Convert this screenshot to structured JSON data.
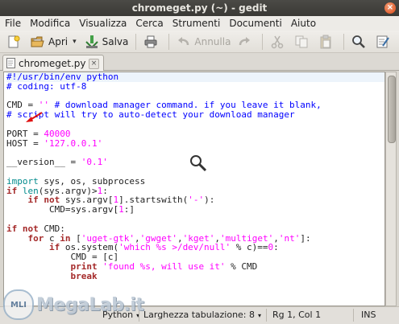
{
  "window": {
    "title": "chromeget.py (~) - gedit",
    "close_symbol": "×"
  },
  "menubar": {
    "items": [
      "File",
      "Modifica",
      "Visualizza",
      "Cerca",
      "Strumenti",
      "Documenti",
      "Aiuto"
    ]
  },
  "toolbar": {
    "open_label": "Apri",
    "save_label": "Salva",
    "undo_label": "Annulla",
    "dropdown_symbol": "▾"
  },
  "tab": {
    "label": "chromeget.py",
    "close_symbol": "×"
  },
  "editor": {
    "lines": [
      [
        {
          "t": "#!/usr/bin/env python",
          "c": "pp"
        }
      ],
      [
        {
          "t": "# coding: utf-8",
          "c": "cmt"
        }
      ],
      [],
      [
        {
          "t": "CMD = "
        },
        {
          "t": "''",
          "c": "str"
        },
        {
          "t": " # download manager command. if you leave it blank,",
          "c": "cmt"
        }
      ],
      [
        {
          "t": "# script will try to auto-detect your download manager",
          "c": "cmt"
        }
      ],
      [],
      [
        {
          "t": "PORT = "
        },
        {
          "t": "40000",
          "c": "num"
        }
      ],
      [
        {
          "t": "HOST = "
        },
        {
          "t": "'127.0.0.1'",
          "c": "str"
        }
      ],
      [],
      [
        {
          "t": "__version__ = "
        },
        {
          "t": "'0.1'",
          "c": "str"
        }
      ],
      [],
      [
        {
          "t": "import",
          "c": "ident"
        },
        {
          "t": " sys, os, subprocess"
        }
      ],
      [
        {
          "t": "if",
          "c": "kw"
        },
        {
          "t": " "
        },
        {
          "t": "len",
          "c": "fn"
        },
        {
          "t": "(sys.argv)>"
        },
        {
          "t": "1",
          "c": "num"
        },
        {
          "t": ":"
        }
      ],
      [
        {
          "t": "    "
        },
        {
          "t": "if not",
          "c": "kw"
        },
        {
          "t": " sys.argv["
        },
        {
          "t": "1",
          "c": "num"
        },
        {
          "t": "].startswith("
        },
        {
          "t": "'-'",
          "c": "str"
        },
        {
          "t": "):"
        }
      ],
      [
        {
          "t": "        CMD=sys.argv["
        },
        {
          "t": "1",
          "c": "num"
        },
        {
          "t": ":]"
        }
      ],
      [],
      [
        {
          "t": "if not",
          "c": "kw"
        },
        {
          "t": " CMD:"
        }
      ],
      [
        {
          "t": "    "
        },
        {
          "t": "for",
          "c": "kw"
        },
        {
          "t": " c "
        },
        {
          "t": "in",
          "c": "kw"
        },
        {
          "t": " ["
        },
        {
          "t": "'uget-gtk'",
          "c": "str"
        },
        {
          "t": ","
        },
        {
          "t": "'gwget'",
          "c": "str"
        },
        {
          "t": ","
        },
        {
          "t": "'kget'",
          "c": "str"
        },
        {
          "t": ","
        },
        {
          "t": "'multiget'",
          "c": "str"
        },
        {
          "t": ","
        },
        {
          "t": "'nt'",
          "c": "str"
        },
        {
          "t": "]:"
        }
      ],
      [
        {
          "t": "        "
        },
        {
          "t": "if",
          "c": "kw"
        },
        {
          "t": " os.system("
        },
        {
          "t": "'which %s >/dev/null'",
          "c": "str"
        },
        {
          "t": " % c)=="
        },
        {
          "t": "0",
          "c": "num"
        },
        {
          "t": ":"
        }
      ],
      [
        {
          "t": "            CMD = [c]"
        }
      ],
      [
        {
          "t": "            "
        },
        {
          "t": "print",
          "c": "kw"
        },
        {
          "t": " "
        },
        {
          "t": "'found %s, will use it'",
          "c": "str"
        },
        {
          "t": " % CMD"
        }
      ],
      [
        {
          "t": "            "
        },
        {
          "t": "break",
          "c": "kw"
        }
      ],
      [],
      []
    ]
  },
  "statusbar": {
    "language": "Python",
    "tab_width": "Larghezza tabulazione: 8",
    "position": "Rg 1, Col 1",
    "mode": "INS",
    "dropdown_symbol": "▾"
  },
  "watermark": {
    "text": "MegaLab.it",
    "logo_text": "MLI"
  },
  "colors": {
    "keyword": "#a52a2a",
    "comment": "#0000ff",
    "string": "#ff00ff",
    "builtin": "#008a8c"
  }
}
